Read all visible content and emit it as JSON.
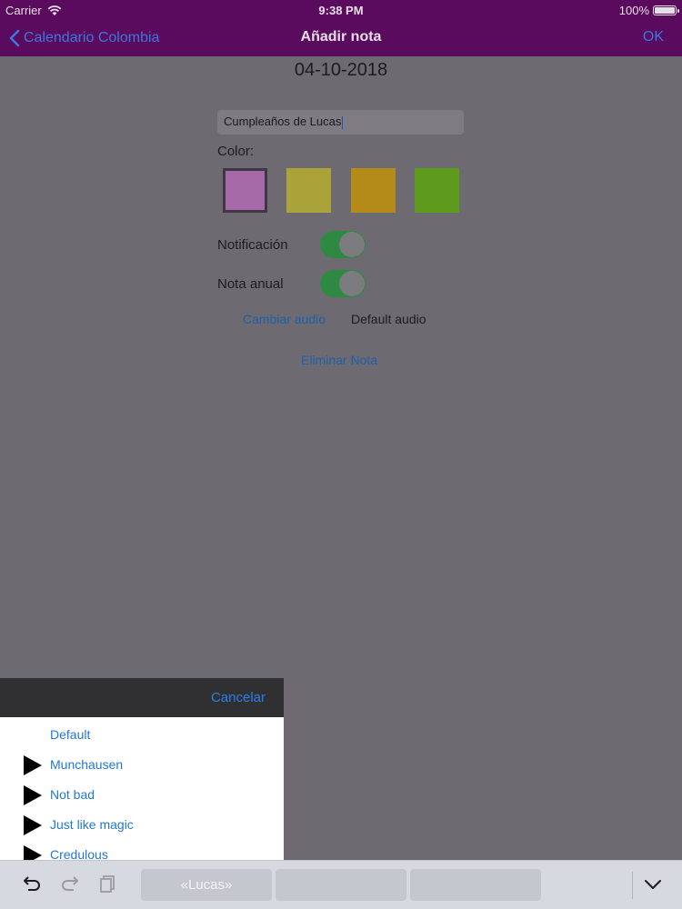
{
  "status_bar": {
    "carrier": "Carrier",
    "time": "9:38 PM",
    "battery": "100%",
    "battery_level": 1.0
  },
  "nav": {
    "back_label": "Calendario Colombia",
    "title": "Añadir nota",
    "ok_label": "OK"
  },
  "form": {
    "date": "04-10-2018",
    "note_text": "Cumpleaños de Lucas",
    "color_label": "Color:",
    "colors": [
      "#a569a8",
      "#a9a33a",
      "#b48a18",
      "#5e9a1c"
    ],
    "selected_color_index": 0,
    "notification_label": "Notificación",
    "notification_on": true,
    "annual_label": "Nota anual",
    "annual_on": true,
    "change_audio_label": "Cambiar audio",
    "audio_value": "Default audio",
    "delete_label": "Eliminar Nota"
  },
  "sheet": {
    "cancel_label": "Cancelar",
    "items": [
      {
        "label": "Default",
        "icon": "none"
      },
      {
        "label": "Munchausen",
        "icon": "play-icon"
      },
      {
        "label": "Not bad",
        "icon": "play-icon"
      },
      {
        "label": "Just like magic",
        "icon": "play-icon"
      },
      {
        "label": "Credulous",
        "icon": "play-icon"
      }
    ]
  },
  "keyboard_bar": {
    "suggestions": [
      "«Lucas»",
      "",
      ""
    ],
    "icons": [
      "undo-icon",
      "redo-icon",
      "paste-icon",
      "dismiss-keyboard-icon"
    ]
  }
}
